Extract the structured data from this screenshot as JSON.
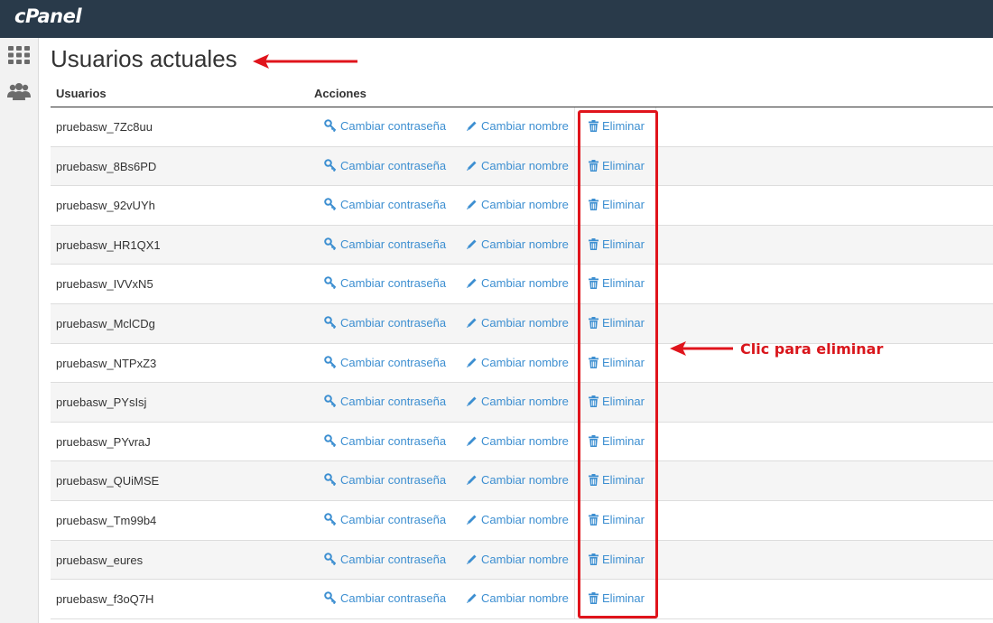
{
  "brand": {
    "logo_text": "cPanel"
  },
  "sidebar": {
    "items": [
      {
        "icon": "grid-icon"
      },
      {
        "icon": "users-icon"
      }
    ]
  },
  "main": {
    "title": "Usuarios actuales",
    "columns": {
      "users": "Usuarios",
      "actions": "Acciones"
    },
    "actions": {
      "change_password": "Cambiar contraseña",
      "rename": "Cambiar nombre",
      "delete": "Eliminar"
    },
    "users": [
      "pruebasw_7Zc8uu",
      "pruebasw_8Bs6PD",
      "pruebasw_92vUYh",
      "pruebasw_HR1QX1",
      "pruebasw_IVVxN5",
      "pruebasw_MclCDg",
      "pruebasw_NTPxZ3",
      "pruebasw_PYsIsj",
      "pruebasw_PYvraJ",
      "pruebasw_QUiMSE",
      "pruebasw_Tm99b4",
      "pruebasw_eures",
      "pruebasw_f3oQ7H"
    ]
  },
  "annotations": {
    "delete_hint": "Clic para eliminar",
    "color": "#e0141c"
  },
  "colors": {
    "topbar": "#293a4a",
    "link": "#3d8fd1"
  }
}
